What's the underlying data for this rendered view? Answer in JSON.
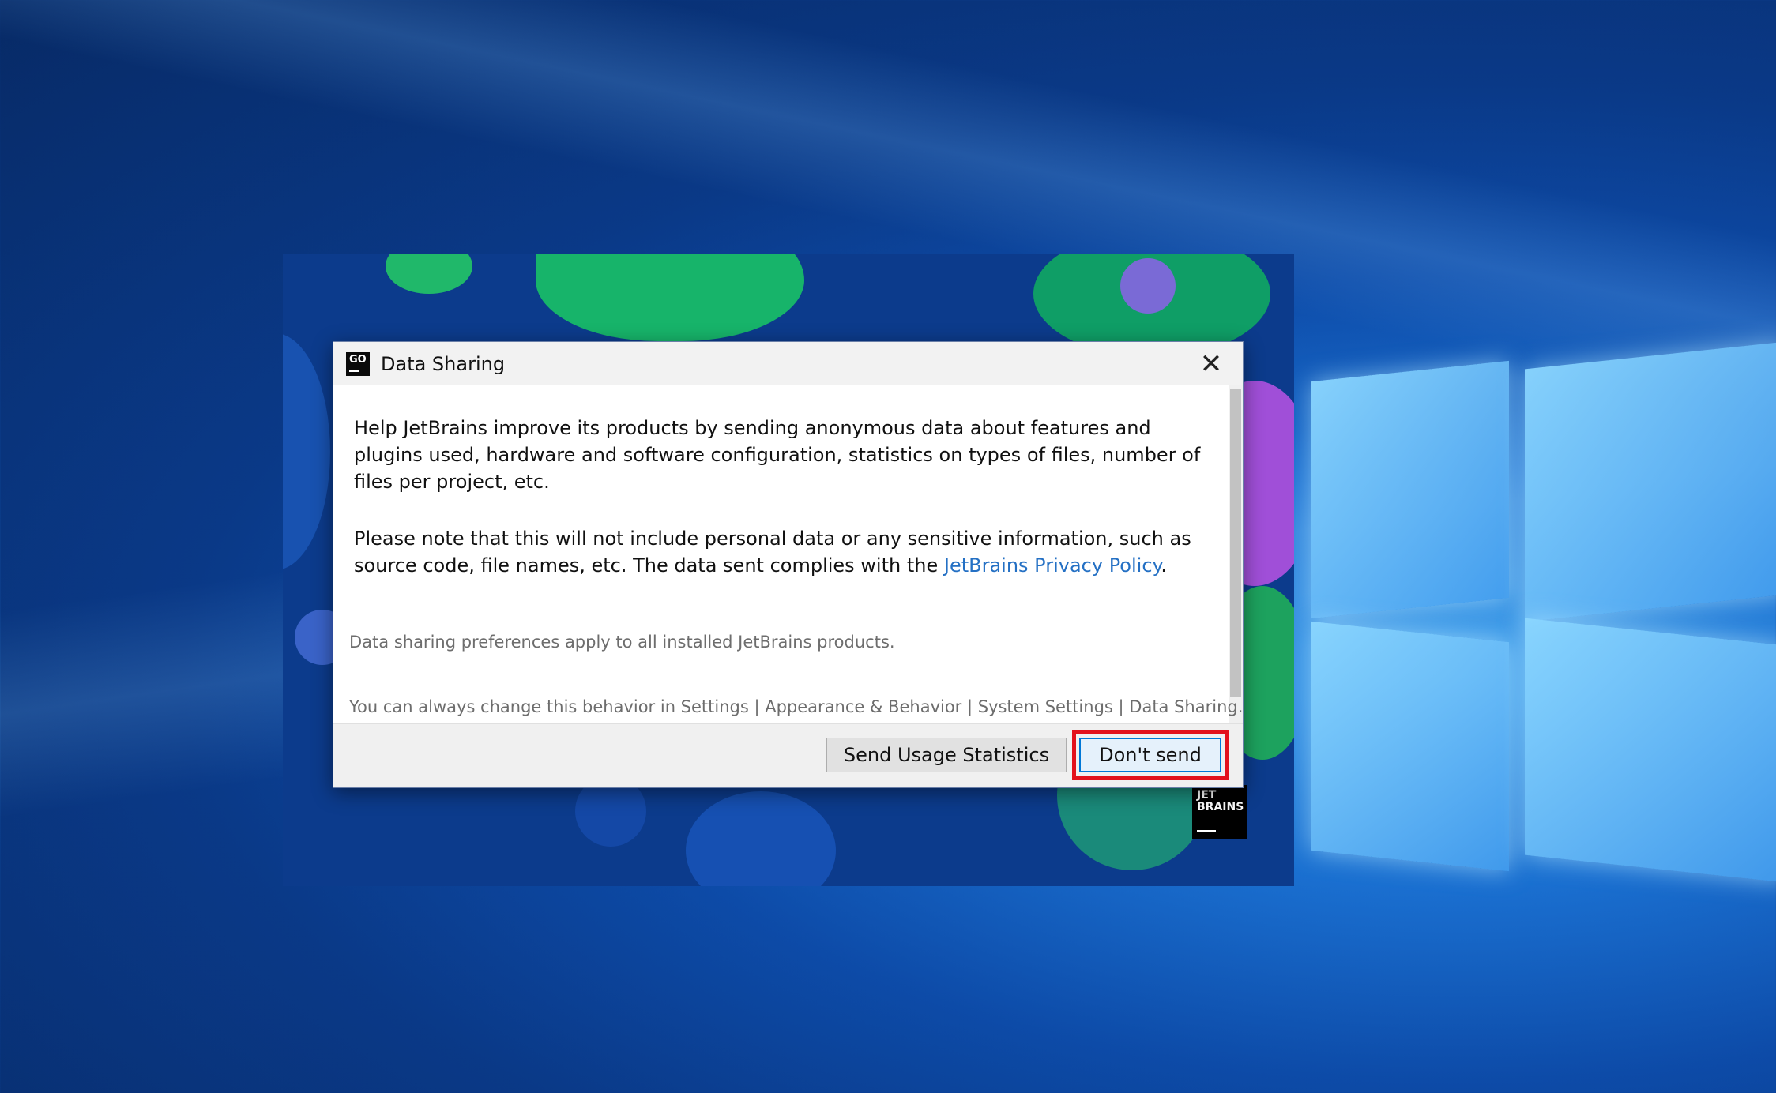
{
  "dialog": {
    "title": "Data Sharing",
    "app_icon_text": "GO",
    "close_glyph": "✕",
    "paragraph1": "Help JetBrains improve its products by sending anonymous data about features and plugins used, hardware and software configuration, statistics on types of files, number of files per project, etc.",
    "paragraph2_before": "Please note that this will not include personal data or any sensitive information, such as source code, file names, etc. The data sent complies with the ",
    "paragraph2_link": "JetBrains Privacy Policy",
    "paragraph2_after": ".",
    "note1": "Data sharing preferences apply to all installed JetBrains products.",
    "note2": "You can always change this behavior in Settings | Appearance & Behavior | System Settings | Data Sharing.",
    "send_button": "Send Usage Statistics",
    "dont_send_button": "Don't send"
  },
  "splash": {
    "logo_text_line1": "JET",
    "logo_text_line2": "BRAINS"
  },
  "colors": {
    "link": "#2470c4",
    "highlight": "#e3121c",
    "focus": "#0078d7"
  }
}
